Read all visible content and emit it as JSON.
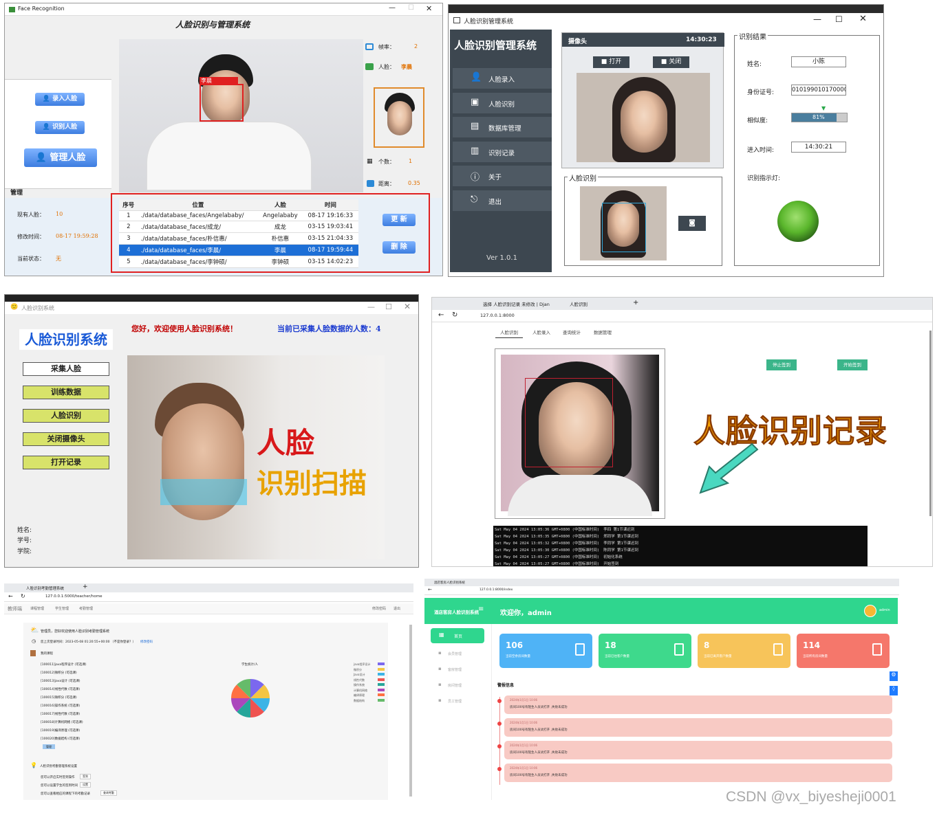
{
  "p1": {
    "win_title": "Face Recognition",
    "title": "人脸识别与管理系统",
    "btn_enroll": "录入人脸",
    "btn_recog": "识别人脸",
    "btn_manage": "管理人脸",
    "section_manage": "管理",
    "fps_label": "帧率：",
    "fps_value": "2",
    "face_label": "人脸：",
    "face_value": "李晨",
    "box_label": "李晨",
    "count_label": "个数：",
    "count_value": "1",
    "dist_label": "距离：",
    "dist_value": "0.35",
    "existing_label": "现有人脸：",
    "existing_value": "10",
    "modtime_label": "修改时间：",
    "modtime_value": "08-17 19:59:28",
    "status_label": "当前状态：",
    "status_value": "无",
    "btn_update": "更 新",
    "btn_delete": "删 除",
    "table_headers": [
      "序号",
      "位置",
      "人脸",
      "时间"
    ],
    "rows": [
      [
        "1",
        "./data/database_faces/Angelababy/",
        "Angelababy",
        "08-17 19:16:33"
      ],
      [
        "2",
        "./data/database_faces/成龙/",
        "成龙",
        "03-15 19:03:41"
      ],
      [
        "3",
        "./data/database_faces/朴信惠/",
        "朴信惠",
        "03-15 21:04:33"
      ],
      [
        "4",
        "./data/database_faces/李晨/",
        "李晨",
        "08-17 19:59:44"
      ],
      [
        "5",
        "./data/database_faces/李钟硕/",
        "李钟硕",
        "03-15 14:02:23"
      ]
    ]
  },
  "p2": {
    "win_title": "人脸识别管理系统",
    "app_title": "人脸识别管理系统",
    "menu": [
      "人脸录入",
      "人脸识别",
      "数据库管理",
      "识别记录",
      "关于",
      "退出"
    ],
    "version": "Ver 1.0.1",
    "camera_label": "摄像头",
    "camera_time": "14:30:23",
    "btn_open": "打开",
    "btn_close": "关闭",
    "recog_group": "人脸识别",
    "result_group": "识别结果",
    "name_label": "姓名:",
    "name_value": "小陈",
    "id_label": "身份证号:",
    "id_value": "010199010170000",
    "sim_label": "相似度:",
    "sim_value": "81%",
    "sim_fraction": 0.81,
    "time_label": "进入时间:",
    "time_value": "14:30:21",
    "light_label": "识别指示灯:"
  },
  "p3": {
    "win_title": "人脸识别系统",
    "app_title": "人脸识别系统",
    "welcome": "您好，欢迎使用人脸识别系统！",
    "count_text": "当前已采集人脸数据的人数：4",
    "buttons": [
      "采集人脸",
      "训练数据",
      "人脸识别",
      "关闭摄像头",
      "打开记录"
    ],
    "info_labels": [
      "姓名:",
      "学号:",
      "学院:"
    ],
    "banner1": "人脸",
    "banner2": "识别扫描"
  },
  "p4": {
    "tab1": "选择 人脸识别记录 未修改 | Djan",
    "tab2": "人脸识别",
    "url": "127.0.0.1:8000",
    "nav": [
      "人脸识别",
      "人脸录入",
      "查询统计",
      "数据管理"
    ],
    "btn_stop": "停止签到",
    "btn_start": "开始签到",
    "big_title": "人脸识别记录",
    "logs": [
      [
        "Sat May 04 2024 13:05:36 GMT+0800 (中国标准时间)",
        "李四 第1节课迟到"
      ],
      [
        "Sat May 04 2024 13:05:35 GMT+0800 (中国标准时间)",
        "郑同学 第1节课迟到"
      ],
      [
        "Sat May 04 2024 13:05:32 GMT+0800 (中国标准时间)",
        "李同学 第1节课迟到"
      ],
      [
        "Sat May 04 2024 13:05:30 GMT+0800 (中国标准时间)",
        "陈同学 第1节课迟到"
      ],
      [
        "Sat May 04 2024 13:05:27 GMT+0800 (中国标准时间)",
        "初始化系统"
      ],
      [
        "Sat May 04 2024 13:05:27 GMT+0800 (中国标准时间)",
        "开始签到"
      ]
    ]
  },
  "p5": {
    "tab": "人脸识别考勤管理系统",
    "url": "127.0.0.1:5000/teacher/home",
    "brand": "教师端",
    "nav": [
      "课程管理",
      "学生管理",
      "考勤管理"
    ],
    "top_right": [
      "修改密码",
      "退出"
    ],
    "greet": "管理员，您好欢迎使用人脸识别考勤管理系统",
    "last_login": "您上次登录时间：2023-05-08 01:20:55+00:00 （不是你登录？）",
    "change_pw": "修改密码",
    "my_courses": "我的课程",
    "courses": [
      "[100011]java程序设计 (可选课)",
      "[100012]微积分 (可选课)",
      "[100013]java设计 (可选课)",
      "[100014]线性代数 (可选课)",
      "[100015]微积分 (可选课)",
      "[100016]操作系统 (可选课)",
      "[100017]线性代数 (可选课)",
      "[100018]计算机网络 (可选课)",
      "[100019]编译原理 (可选课)",
      "[100020]数据结构 (可选课)"
    ],
    "manage_btn": "管理",
    "chart_title": "学生统计/人",
    "legend": [
      "java程序设计",
      "微积分",
      "Java设计",
      "线性代数",
      "操作系统",
      "计算机网络",
      "编译原理",
      "数据结构"
    ],
    "tips_title": "人脸识别考勤管理系统设置",
    "tips": [
      "您可以开启实时签到操作",
      "您可以设置学生的签到时间",
      "您可以查看相应的课程下的考勤记录"
    ],
    "tip_btns": [
      "签到",
      "设置",
      "查询考勤"
    ],
    "colors": [
      "#7b68ee",
      "#f4c542",
      "#3cb4e6",
      "#ef5350",
      "#26a69a",
      "#ab47bc",
      "#ff7043",
      "#66bb6a"
    ]
  },
  "p6": {
    "tab": "酒店客房人脸识别系统",
    "url": "127.0.0.1:8000/index",
    "brand": "酒店客房人脸识别系统",
    "welcome": "欢迎你，admin",
    "user": "admin",
    "side": [
      "首页",
      "会员管理",
      "客房管理",
      "房间管理",
      "员工管理"
    ],
    "cards": [
      {
        "num": "106",
        "label": "当前空余房间数量",
        "color": "#4fb3f6"
      },
      {
        "num": "18",
        "label": "当前已住客户数量",
        "color": "#3ed98c"
      },
      {
        "num": "8",
        "label": "当前已离开客户数量",
        "color": "#f7c45a"
      },
      {
        "num": "114",
        "label": "当前所有房间数量",
        "color": "#f5776b"
      }
    ],
    "alert_title": "警报信息",
    "alerts": [
      {
        "time": "2024年1月1日 10:06",
        "text": "房间100号有陌生人员试打开 ,失败未成功"
      },
      {
        "time": "2024年1月1日 10:06",
        "text": "房间100号有陌生人员试打开 ,失败未成功"
      },
      {
        "time": "2024年1月1日 10:06",
        "text": "房间100号有陌生人员试打开 ,失败未成功"
      },
      {
        "time": "2024年1月1日 10:06",
        "text": "房间100号有陌生人员试打开 ,失败未成功"
      }
    ]
  },
  "watermark": "CSDN @vx_biyesheji0001"
}
